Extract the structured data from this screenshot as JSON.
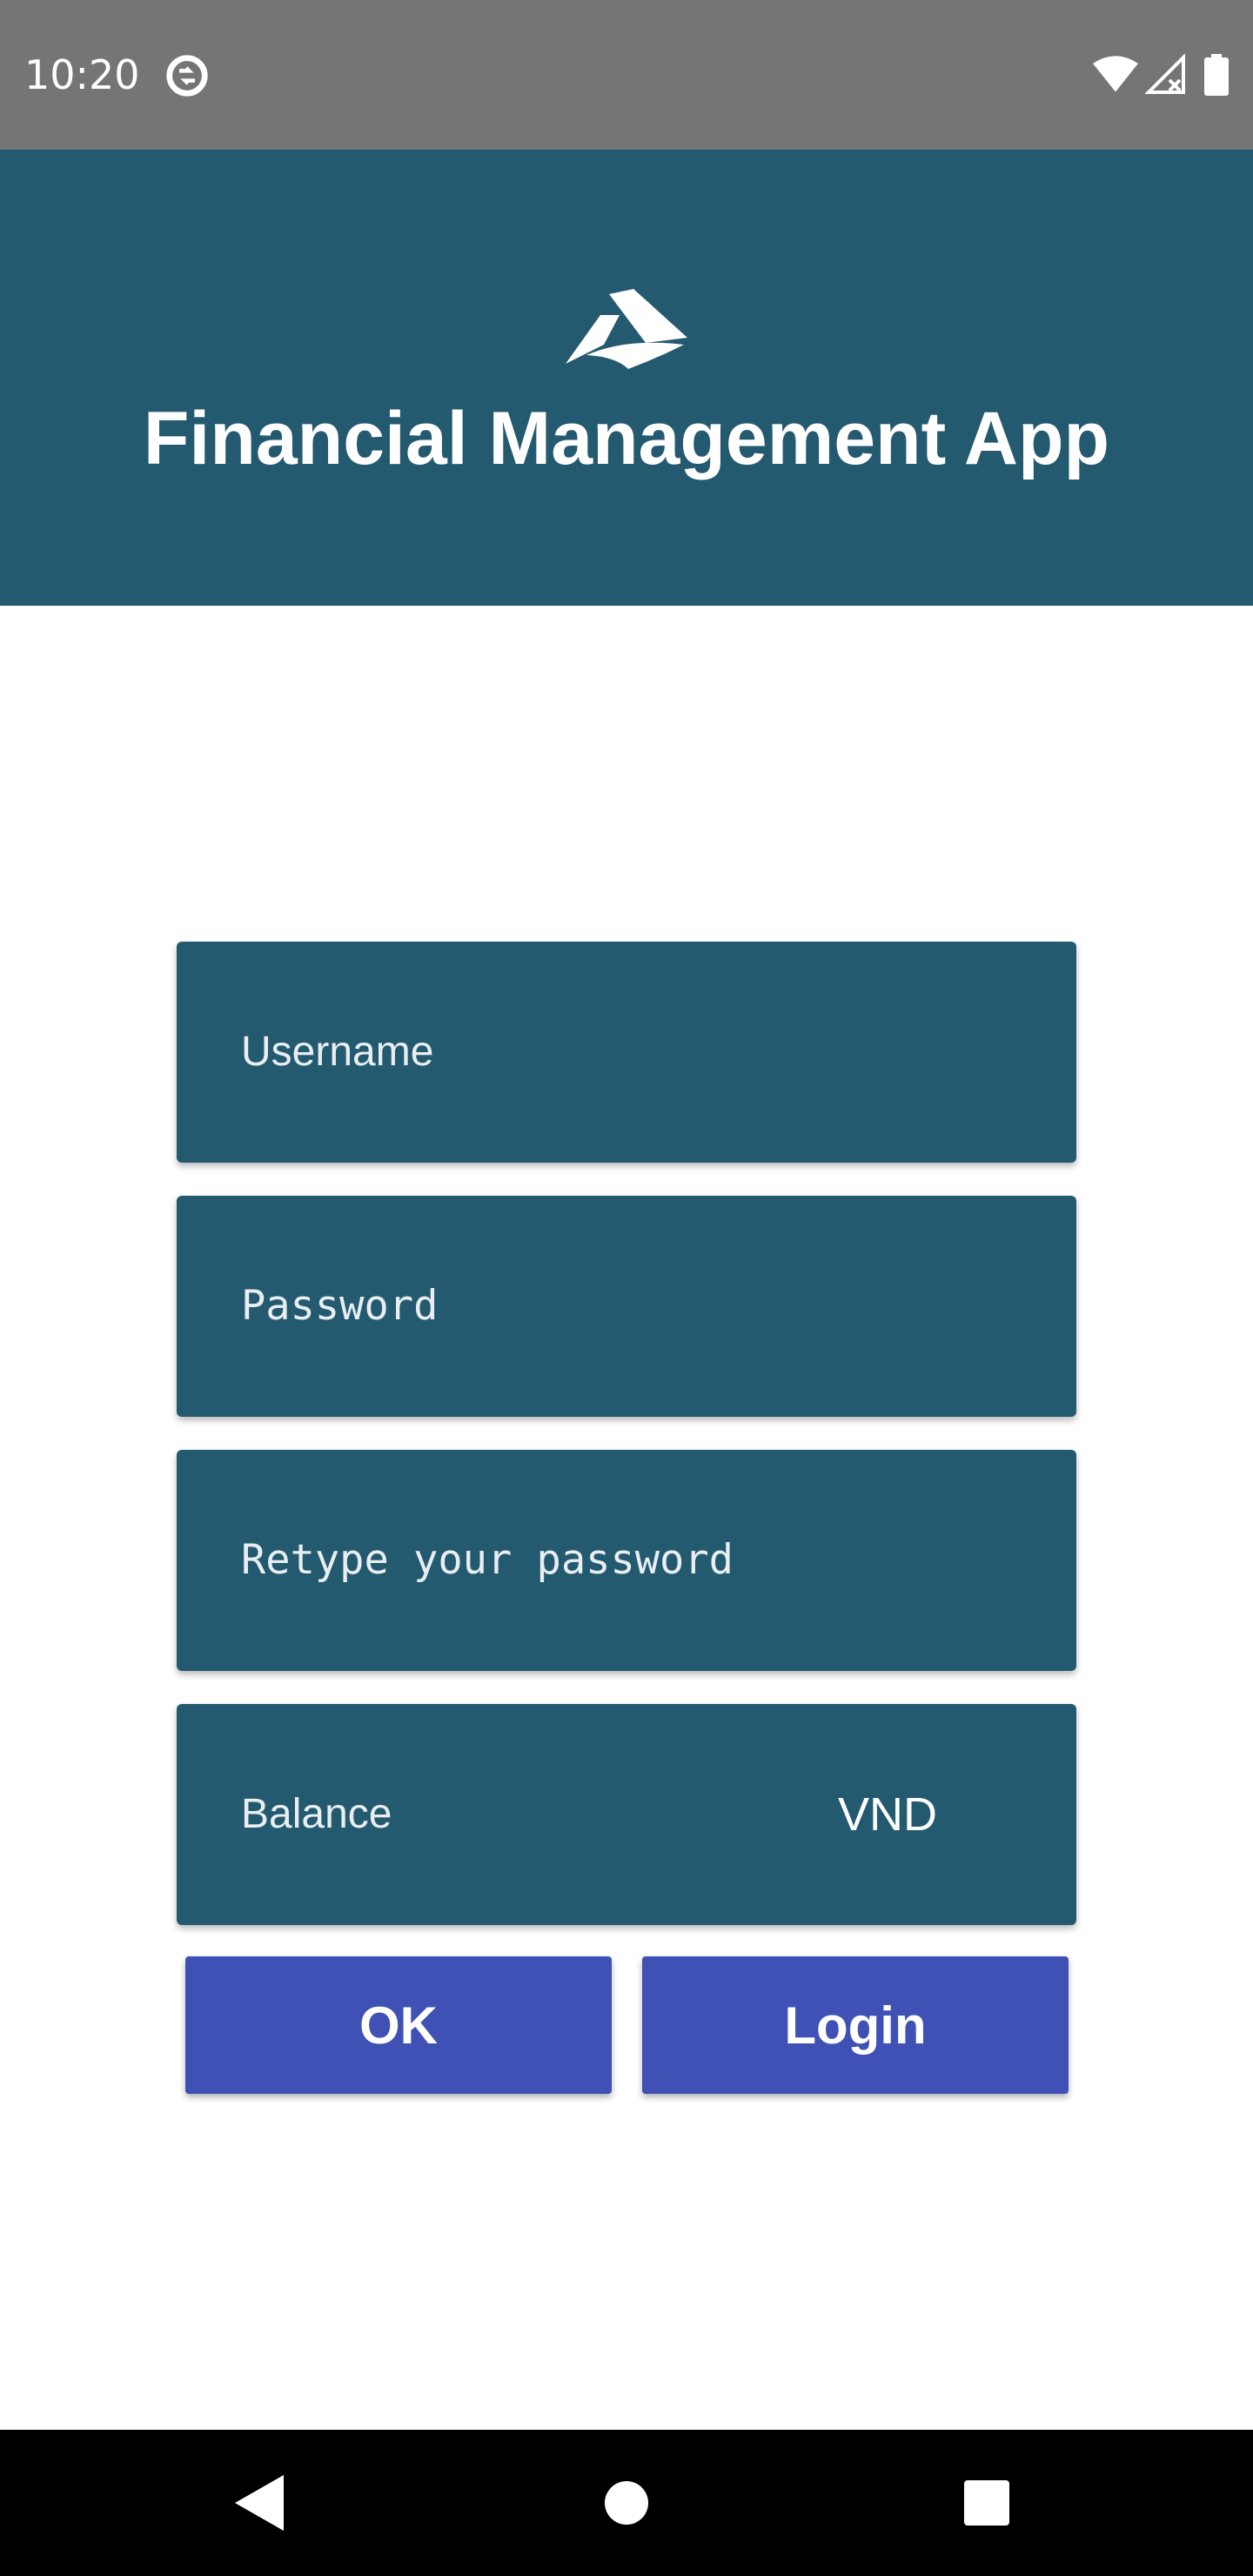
{
  "status_bar": {
    "time": "10:20",
    "icons": [
      "sync-icon",
      "wifi-icon",
      "signal-icon",
      "battery-icon"
    ]
  },
  "header": {
    "logo_icon": "paper-plane-logo-icon",
    "title": "Financial Management App",
    "background_color": "#245a6f"
  },
  "form": {
    "username_placeholder": "Username",
    "password_placeholder": "Password",
    "retype_password_placeholder": "Retype your password",
    "balance_placeholder": "Balance",
    "balance_unit": "VND",
    "field_color": "#245a6f"
  },
  "buttons": {
    "ok_label": "OK",
    "login_label": "Login",
    "color": "#3f51b5"
  },
  "nav_bar": {
    "icons": [
      "back-icon",
      "home-icon",
      "recents-icon"
    ]
  }
}
